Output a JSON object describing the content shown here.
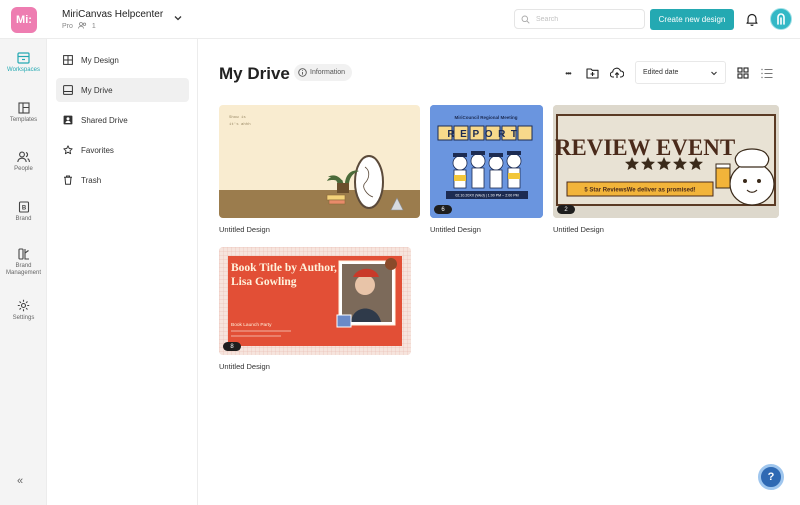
{
  "brand": {
    "logo_text": "Mi:",
    "logo_color": "#ee7db1",
    "accent": "#24a9b2"
  },
  "workspace": {
    "name": "MiriCanvas Helpcenter",
    "plan": "Pro",
    "members": "1"
  },
  "search": {
    "placeholder": "Search"
  },
  "header": {
    "create_label": "Create new design"
  },
  "rail": {
    "items": [
      {
        "label": "Workspaces",
        "icon": "workspace-icon"
      },
      {
        "label": "Templates",
        "icon": "templates-icon"
      },
      {
        "label": "People",
        "icon": "people-icon"
      },
      {
        "label": "Brand",
        "icon": "brand-icon"
      },
      {
        "label": "Brand Management",
        "icon": "brand-management-icon"
      },
      {
        "label": "Settings",
        "icon": "gear-icon"
      }
    ],
    "collapse_glyph": "«"
  },
  "sidebar": {
    "items": [
      {
        "label": "My Design",
        "icon": "grid-icon"
      },
      {
        "label": "My Drive",
        "icon": "drive-icon"
      },
      {
        "label": "Shared Drive",
        "icon": "shared-drive-icon"
      },
      {
        "label": "Favorites",
        "icon": "star-icon"
      },
      {
        "label": "Trash",
        "icon": "trash-icon"
      }
    ]
  },
  "main": {
    "title": "My Drive",
    "info_label": "Information",
    "more_glyph": "•••",
    "sort": {
      "selected": "Edited date"
    },
    "designs": [
      {
        "title": "Untitled Design",
        "badge": "",
        "thumb_text": [
          "Show is",
          "it's ahhh"
        ]
      },
      {
        "title": "Untitled Design",
        "badge": "6",
        "thumb_text": [
          "MiriCouncil Regional Meeting",
          "REPORT",
          "02.10.20XX (Wed) | 1:00 PM ~ 2:00 PM"
        ]
      },
      {
        "title": "Untitled Design",
        "badge": "2",
        "thumb_text": [
          "REVIEW EVENT",
          "5 Star ReviewsWe deliver as promised!"
        ]
      },
      {
        "title": "Untitled Design",
        "badge": "8",
        "thumb_text": [
          "Book Title by Author,",
          "Lisa Gowling",
          "Book Launch Party"
        ]
      }
    ]
  },
  "help": {
    "label": "?"
  }
}
